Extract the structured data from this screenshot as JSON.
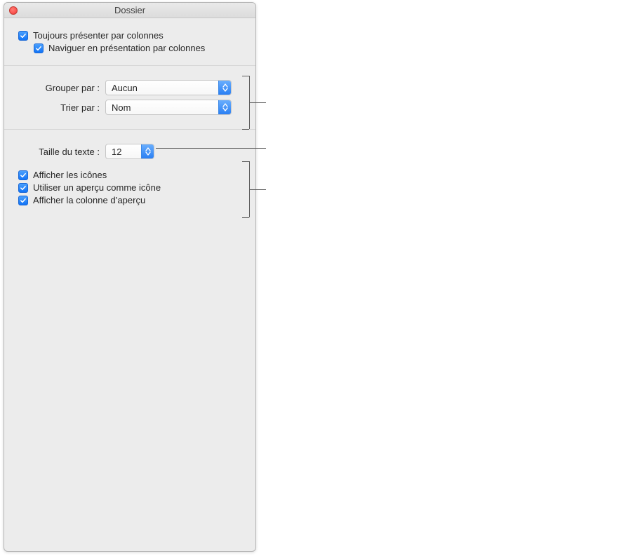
{
  "window": {
    "title": "Dossier"
  },
  "top": {
    "always_columns": "Toujours présenter par colonnes",
    "browse_columns": "Naviguer en présentation par colonnes"
  },
  "group": {
    "group_by_label": "Grouper par :",
    "group_by_value": "Aucun",
    "sort_by_label": "Trier par :",
    "sort_by_value": "Nom"
  },
  "text": {
    "size_label": "Taille du texte :",
    "size_value": "12"
  },
  "show": {
    "icons": "Afficher les icônes",
    "preview_as_icon": "Utiliser un aperçu comme icône",
    "preview_column": "Afficher la colonne d’aperçu"
  }
}
